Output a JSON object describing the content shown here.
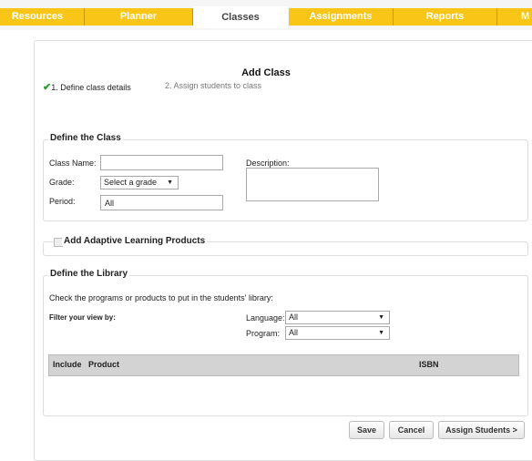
{
  "nav": {
    "tabs": [
      {
        "label": "Resources"
      },
      {
        "label": "Planner"
      },
      {
        "label": "Classes"
      },
      {
        "label": "Assignments"
      },
      {
        "label": "Reports"
      },
      {
        "label": "M"
      }
    ],
    "active_index": 2
  },
  "page": {
    "title": "Add Class",
    "steps": [
      {
        "label": "1. Define class details",
        "completed": true
      },
      {
        "label": "2. Assign students to class",
        "completed": false
      }
    ]
  },
  "define_class": {
    "legend": "Define the Class",
    "class_name_label": "Class Name:",
    "class_name_value": "",
    "grade_label": "Grade:",
    "grade_value": "Select a grade",
    "period_label": "Period:",
    "period_value": "All",
    "description_label": "Description:"
  },
  "adaptive": {
    "label": "Add Adaptive Learning Products"
  },
  "library": {
    "legend": "Define the Library",
    "instructions": "Check the programs or products to put in the students' library:",
    "filter_label": "Filter your view by:",
    "language_label": "Language:",
    "language_value": "All",
    "program_label": "Program:",
    "program_value": "All",
    "columns": {
      "include": "Include",
      "product": "Product",
      "isbn": "ISBN"
    }
  },
  "buttons": {
    "save": "Save",
    "cancel": "Cancel",
    "assign": "Assign Students >"
  },
  "colors": {
    "tab": "#f9c516",
    "check": "#2a9d2a"
  }
}
